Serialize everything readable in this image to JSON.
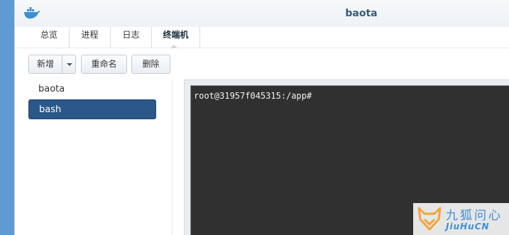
{
  "window": {
    "title": "baota",
    "icon": "docker-whale-icon"
  },
  "tabs": [
    {
      "label": "总览",
      "active": false
    },
    {
      "label": "进程",
      "active": false
    },
    {
      "label": "日志",
      "active": false
    },
    {
      "label": "终端机",
      "active": true
    }
  ],
  "toolbar": {
    "new_label": "新增",
    "rename_label": "重命名",
    "delete_label": "删除"
  },
  "sidebar": {
    "items": [
      {
        "label": "baota",
        "selected": false
      },
      {
        "label": "bash",
        "selected": true
      }
    ]
  },
  "terminal": {
    "prompt": "root@31957f045315:/app#"
  },
  "watermark": {
    "text_cn": "九狐问心",
    "text_en": "JiuHuCN"
  },
  "colors": {
    "desktop": "#5f9bd0",
    "selected_item": "#2b5789",
    "terminal_bg": "#303030",
    "title_text": "#3a5a78"
  }
}
